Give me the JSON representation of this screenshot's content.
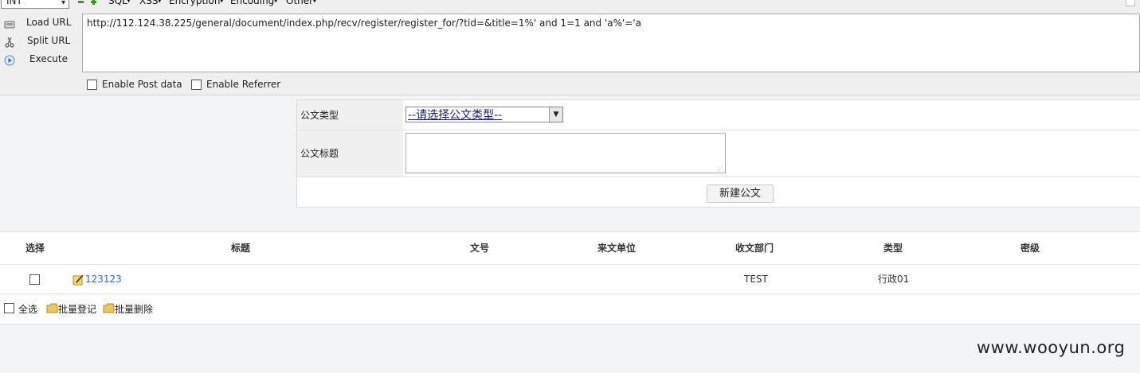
{
  "hackbar": {
    "type_select": "INT",
    "menus": [
      "SQL",
      "XSS",
      "Encryption",
      "Encoding",
      "Other"
    ],
    "load_url": "Load URL",
    "split_url": "Split URL",
    "execute": "Execute",
    "url": "http://112.124.38.225/general/document/index.php/recv/register/register_for/?tid=&title=1%' and 1=1 and 'a%'='a",
    "enable_post": "Enable Post data",
    "enable_referrer": "Enable Referrer"
  },
  "form": {
    "type_label": "公文类型",
    "type_value": "--请选择公文类型--",
    "title_label": "公文标题",
    "new_button": "新建公文"
  },
  "list": {
    "headers": [
      "选择",
      "标题",
      "文号",
      "来文单位",
      "收文部门",
      "类型",
      "密级"
    ],
    "rows": [
      {
        "title": "123123",
        "doc_no": "",
        "from_unit": "",
        "dept": "TEST",
        "type": "行政01",
        "secret": ""
      }
    ],
    "select_all": "全选",
    "batch_register": "批量登记",
    "batch_delete": "批量删除"
  },
  "watermark": "www.wooyun.org",
  "colors": {
    "link": "#2a6fbf",
    "toolbar_bg": "#efefef",
    "page_bg": "#f3f4f5"
  }
}
